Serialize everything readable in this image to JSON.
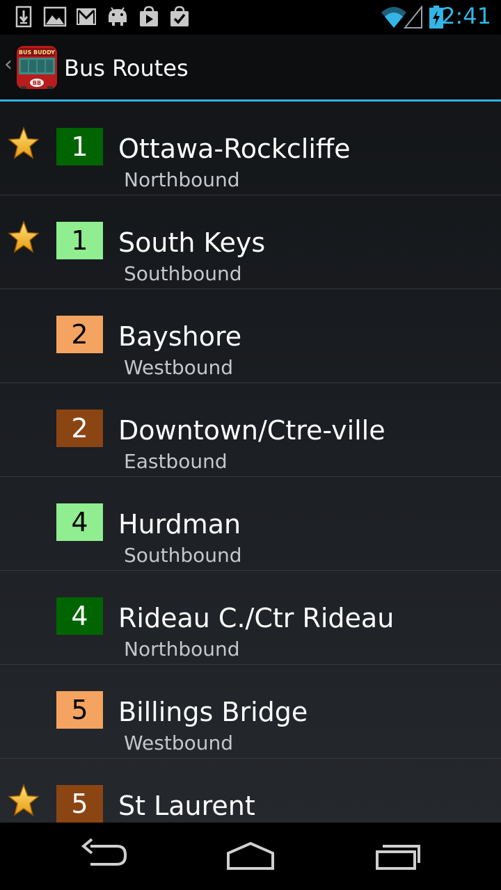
{
  "status_bar": {
    "time": "2:41",
    "notification_icons": [
      "download-icon",
      "gallery-icon",
      "gmail-icon",
      "android-icon",
      "play-store-icon",
      "task-check-icon"
    ],
    "system_icons": [
      "wifi-icon",
      "signal-icon",
      "battery-charging-icon"
    ],
    "accent": "#33b5e5"
  },
  "action_bar": {
    "title": "Bus Routes",
    "logo_text": "BUS BUDDY",
    "logo_badge": "BB"
  },
  "routes": [
    {
      "number": "1",
      "name": "Ottawa-Rockcliffe",
      "direction": "Northbound",
      "favorite": true,
      "badge_bg": "#006400",
      "badge_fg": "#ffffff"
    },
    {
      "number": "1",
      "name": "South Keys",
      "direction": "Southbound",
      "favorite": true,
      "badge_bg": "#90ee90",
      "badge_fg": "#000000"
    },
    {
      "number": "2",
      "name": "Bayshore",
      "direction": "Westbound",
      "favorite": false,
      "badge_bg": "#f4a460",
      "badge_fg": "#000000"
    },
    {
      "number": "2",
      "name": "Downtown/Ctre-ville",
      "direction": "Eastbound",
      "favorite": false,
      "badge_bg": "#8b4513",
      "badge_fg": "#ffffff"
    },
    {
      "number": "4",
      "name": "Hurdman",
      "direction": "Southbound",
      "favorite": false,
      "badge_bg": "#90ee90",
      "badge_fg": "#000000"
    },
    {
      "number": "4",
      "name": "Rideau C./Ctr Rideau",
      "direction": "Northbound",
      "favorite": false,
      "badge_bg": "#006400",
      "badge_fg": "#ffffff"
    },
    {
      "number": "5",
      "name": "Billings Bridge",
      "direction": "Westbound",
      "favorite": false,
      "badge_bg": "#f4a460",
      "badge_fg": "#000000"
    },
    {
      "number": "5",
      "name": "St Laurent",
      "direction": "",
      "favorite": true,
      "badge_bg": "#8b4513",
      "badge_fg": "#ffffff"
    }
  ],
  "nav_bar": {
    "buttons": [
      "back-icon",
      "home-icon",
      "recent-apps-icon"
    ]
  }
}
